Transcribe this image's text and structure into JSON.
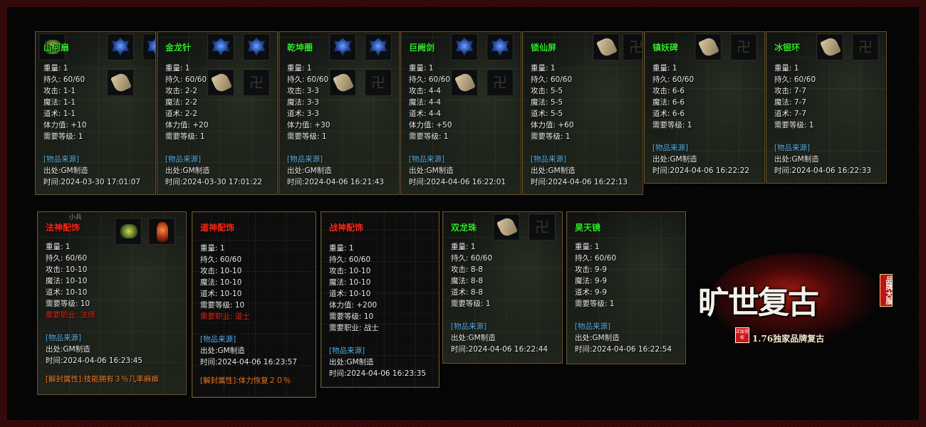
{
  "colors": {
    "name_green": "#31e82a",
    "name_red": "#ff2a1a",
    "source_blue": "#5ab0e6",
    "requirement_red": "#e02a1a",
    "unseal_orange": "#f07a28",
    "stat_white": "#e8e8e8"
  },
  "top_row": [
    {
      "name": "山河扇",
      "lines": [
        "重量: 1",
        "持久: 60/60",
        "攻击: 1-1",
        "魔法: 1-1",
        "道术: 1-1",
        "体力值: +10",
        "需要等级: 1"
      ],
      "source_title": "[物品来源]",
      "source_origin": "出处:GM制造",
      "source_time": "时间:2024-03-30 17:01:07"
    },
    {
      "name": "金龙针",
      "lines": [
        "重量: 1",
        "持久: 60/60",
        "攻击: 2-2",
        "魔法: 2-2",
        "道术: 2-2",
        "体力值: +20",
        "需要等级: 1"
      ],
      "source_title": "[物品来源]",
      "source_origin": "出处:GM制造",
      "source_time": "时间:2024-03-30 17:01:22"
    },
    {
      "name": "乾坤圈",
      "lines": [
        "重量: 1",
        "持久: 60/60",
        "攻击: 3-3",
        "魔法: 3-3",
        "道术: 3-3",
        "体力值: +30",
        "需要等级: 1"
      ],
      "source_title": "[物品来源]",
      "source_origin": "出处:GM制造",
      "source_time": "时间:2024-04-06 16:21:43"
    },
    {
      "name": "巨阙剑",
      "lines": [
        "重量: 1",
        "持久: 60/60",
        "攻击: 4-4",
        "魔法: 4-4",
        "道术: 4-4",
        "体力值: +50",
        "需要等级: 1"
      ],
      "source_title": "[物品来源]",
      "source_origin": "出处:GM制造",
      "source_time": "时间:2024-04-06 16:22:01"
    },
    {
      "name": "锁仙屏",
      "lines": [
        "重量: 1",
        "持久: 60/60",
        "攻击: 5-5",
        "魔法: 5-5",
        "道术: 5-5",
        "体力值: +60",
        "需要等级: 1"
      ],
      "source_title": "[物品来源]",
      "source_origin": "出处:GM制造",
      "source_time": "时间:2024-04-06 16:22:13"
    },
    {
      "name": "镇妖碑",
      "lines": [
        "重量: 1",
        "持久: 60/60",
        "攻击: 6-6",
        "魔法: 6-6",
        "道术: 6-6",
        "需要等级: 1"
      ],
      "source_title": "[物品来源]",
      "source_origin": "出处:GM制造",
      "source_time": "时间:2024-04-06 16:22:22"
    },
    {
      "name": "冰银环",
      "lines": [
        "重量: 1",
        "持久: 60/60",
        "攻击: 7-7",
        "魔法: 7-7",
        "道术: 7-7",
        "需要等级: 1"
      ],
      "source_title": "[物品来源]",
      "source_origin": "出处:GM制造",
      "source_time": "时间:2024-04-06 16:22:33"
    }
  ],
  "bottom_row": [
    {
      "name": "法神配饰",
      "lines": [
        "重量: 1",
        "持久: 60/60",
        "攻击: 10-10",
        "魔法: 10-10",
        "道术: 10-10",
        "需要等级: 10"
      ],
      "requirement": "需要职业: 法师",
      "source_title": "[物品来源]",
      "source_origin": "出处:GM制造",
      "source_time": "时间:2024-04-06 16:23:45",
      "unseal": "[解封属性]:技能拥有３％几率麻痹",
      "tag": "小兵"
    },
    {
      "name": "道神配饰",
      "lines": [
        "重量: 1",
        "持久: 60/60",
        "攻击: 10-10",
        "魔法: 10-10",
        "道术: 10-10",
        "需要等级: 10"
      ],
      "requirement": "需要职业: 道士",
      "source_title": "[物品来源]",
      "source_origin": "出处:GM制造",
      "source_time": "时间:2024-04-06 16:23:57",
      "unseal": "[解封属性]:体力恢复２０％"
    },
    {
      "name": "战神配饰",
      "lines": [
        "重量: 1",
        "持久: 60/60",
        "攻击: 10-10",
        "魔法: 10-10",
        "道术: 10-10",
        "体力值: +200",
        "需要等级: 10",
        "需要职业: 战士"
      ],
      "source_title": "[物品来源]",
      "source_origin": "出处:GM制造",
      "source_time": "时间:2024-04-06 16:23:35"
    },
    {
      "name": "双龙珠",
      "lines": [
        "重量: 1",
        "持久: 60/60",
        "攻击: 8-8",
        "魔法: 8-8",
        "道术: 8-8",
        "需要等级: 1"
      ],
      "source_title": "[物品来源]",
      "source_origin": "出处:GM制造",
      "source_time": "时间:2024-04-06 16:22:44"
    },
    {
      "name": "昊天镜",
      "lines": [
        "重量: 1",
        "持久: 60/60",
        "攻击: 9-9",
        "魔法: 9-9",
        "道术: 9-9",
        "需要等级: 1"
      ],
      "source_title": "[物品来源]",
      "source_origin": "出处:GM制造",
      "source_time": "时间:2024-04-06 16:22:54"
    }
  ],
  "logo": {
    "title": "旷世复古",
    "badge": "品牌大服",
    "seal": "正版授权",
    "subtitle": "1.76独家品牌复古"
  }
}
